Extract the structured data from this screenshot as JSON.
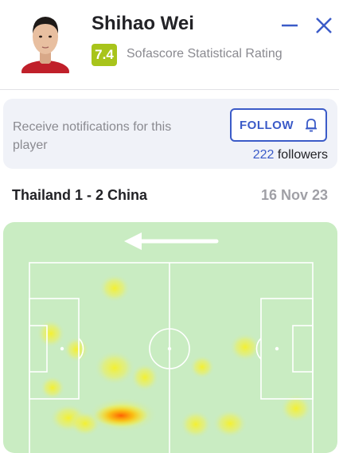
{
  "player": {
    "name": "Shihao Wei",
    "rating": "7.4",
    "rating_label": "Sofascore Statistical Rating",
    "rating_color": "#a8c41b"
  },
  "header_icons": {
    "minimize": "minus-icon",
    "close": "close-icon"
  },
  "notifications": {
    "text": "Receive notifications for this player",
    "follow_label": "FOLLOW",
    "follow_icon": "bell-icon",
    "followers_count": "222",
    "followers_label": "followers"
  },
  "match": {
    "title": "Thailand 1 - 2 China",
    "date": "16 Nov 23"
  },
  "heatmap": {
    "attack_direction": "left",
    "colors": {
      "pitch": "#c9ecc2",
      "lines": "#ffffff",
      "heat_low": "#f6f02a",
      "heat_high": "#ff6a00",
      "accent": "#3b5bc8"
    }
  }
}
